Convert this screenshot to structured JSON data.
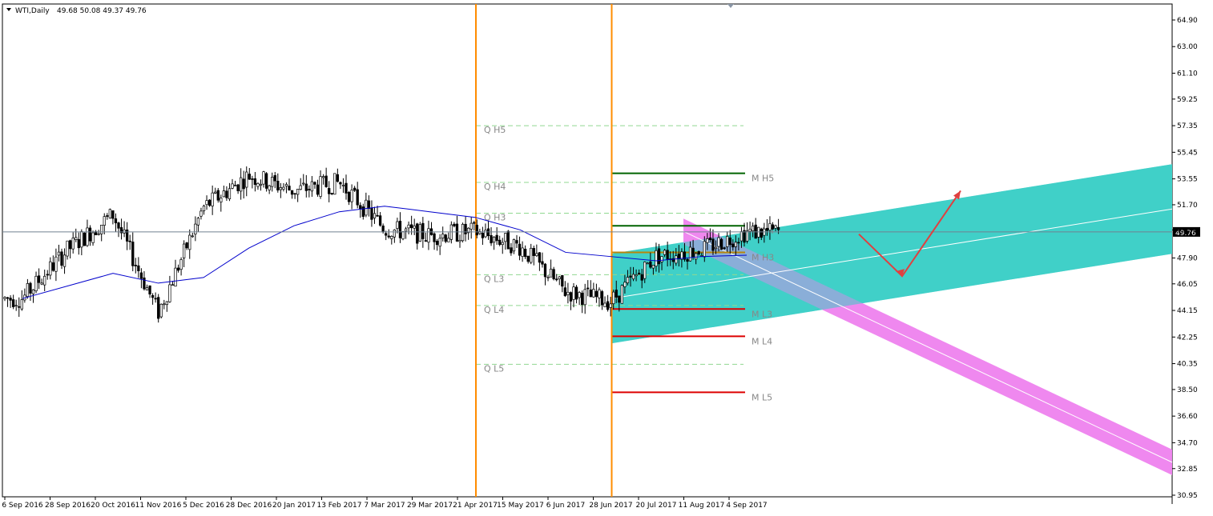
{
  "header": {
    "symbol": "WTI,Daily",
    "ohlc": "49.68 50.08 49.37 49.76"
  },
  "chart_data": {
    "type": "candlestick",
    "symbol": "WTI",
    "timeframe": "Daily",
    "x_tick_labels": [
      "6 Sep 2016",
      "28 Sep 2016",
      "20 Oct 2016",
      "11 Nov 2016",
      "5 Dec 2016",
      "28 Dec 2016",
      "20 Jan 2017",
      "13 Feb 2017",
      "7 Mar 2017",
      "29 Mar 2017",
      "21 Apr 2017",
      "15 May 2017",
      "6 Jun 2017",
      "28 Jun 2017",
      "20 Jul 2017",
      "11 Aug 2017",
      "4 Sep 2017"
    ],
    "y_tick_labels": [
      "64.90",
      "63.00",
      "61.10",
      "59.25",
      "57.35",
      "55.45",
      "53.55",
      "51.70",
      "49.90",
      "47.90",
      "46.05",
      "44.15",
      "42.25",
      "40.35",
      "38.50",
      "36.60",
      "34.70",
      "32.85",
      "30.95"
    ],
    "y_range": [
      30.95,
      64.9
    ],
    "current_price": "49.76",
    "price_path": [
      [
        "6 Sep 2016",
        45.0
      ],
      [
        "28 Sep 2016",
        48.5
      ],
      [
        "20 Oct 2016",
        51.0
      ],
      [
        "11 Nov 2016",
        44.0
      ],
      [
        "5 Dec 2016",
        51.5
      ],
      [
        "28 Dec 2016",
        53.8
      ],
      [
        "20 Jan 2017",
        52.7
      ],
      [
        "13 Feb 2017",
        53.3
      ],
      [
        "7 Mar 2017",
        50.0
      ],
      [
        "29 Mar 2017",
        49.5
      ],
      [
        "21 Apr 2017",
        49.8
      ],
      [
        "15 May 2017",
        48.7
      ],
      [
        "6 Jun 2017",
        45.5
      ],
      [
        "28 Jun 2017",
        44.8
      ],
      [
        "20 Jul 2017",
        48.0
      ],
      [
        "11 Aug 2017",
        48.5
      ],
      [
        "4 Sep 2017",
        49.76
      ]
    ],
    "moving_average": [
      [
        "6 Sep 2016",
        45.0
      ],
      [
        "20 Oct 2016",
        46.8
      ],
      [
        "11 Nov 2016",
        46.1
      ],
      [
        "5 Dec 2016",
        46.5
      ],
      [
        "28 Dec 2016",
        48.6
      ],
      [
        "20 Jan 2017",
        50.2
      ],
      [
        "13 Feb 2017",
        51.2
      ],
      [
        "7 Mar 2017",
        51.6
      ],
      [
        "29 Mar 2017",
        51.2
      ],
      [
        "21 Apr 2017",
        50.8
      ],
      [
        "15 May 2017",
        49.9
      ],
      [
        "6 Jun 2017",
        48.3
      ],
      [
        "28 Jun 2017",
        48.0
      ],
      [
        "20 Jul 2017",
        47.7
      ],
      [
        "11 Aug 2017",
        48.0
      ],
      [
        "4 Sep 2017",
        48.1
      ]
    ],
    "vertical_lines": [
      "21 Apr 2017",
      "28 Jun 2017"
    ],
    "quarterly_levels": [
      {
        "label": "Q  H5",
        "value": 57.35
      },
      {
        "label": "Q  H4",
        "value": 53.3
      },
      {
        "label": "Q  H3",
        "value": 51.1
      },
      {
        "label": "Q  L3",
        "value": 46.7
      },
      {
        "label": "Q  L4",
        "value": 44.5
      },
      {
        "label": "Q  L5",
        "value": 40.3
      }
    ],
    "monthly_levels": [
      {
        "label": "M  H5",
        "value": 53.95,
        "color": "#006400"
      },
      {
        "label": "M  H4",
        "value": 50.2,
        "color": "#006400"
      },
      {
        "label": "M  H3",
        "value": 48.3,
        "color": "#b8860b"
      },
      {
        "label": "M  L3",
        "value": 44.25,
        "color": "#dd0000"
      },
      {
        "label": "M  L4",
        "value": 42.3,
        "color": "#dd0000"
      },
      {
        "label": "M  L5",
        "value": 38.3,
        "color": "#dd0000"
      }
    ],
    "channels": [
      {
        "color": "#40d0c8",
        "from": [
          "28 Jun 2017",
          45.0
        ],
        "to_right_edge": [
          51.4
        ]
      },
      {
        "color": "#ee82ee",
        "from": [
          "20 Jul 2017",
          49.8
        ],
        "to_right_edge": [
          33.3
        ]
      }
    ],
    "projection_arrow": {
      "color": "#e04040",
      "path": [
        49.6,
        46.6,
        52.7
      ]
    },
    "colors": {
      "bull_candle": "#ffffff",
      "bear_candle": "#000000",
      "ma_line": "#0000cc",
      "vertical_line": "#ff8c00",
      "current_price_line": "#708090"
    }
  }
}
